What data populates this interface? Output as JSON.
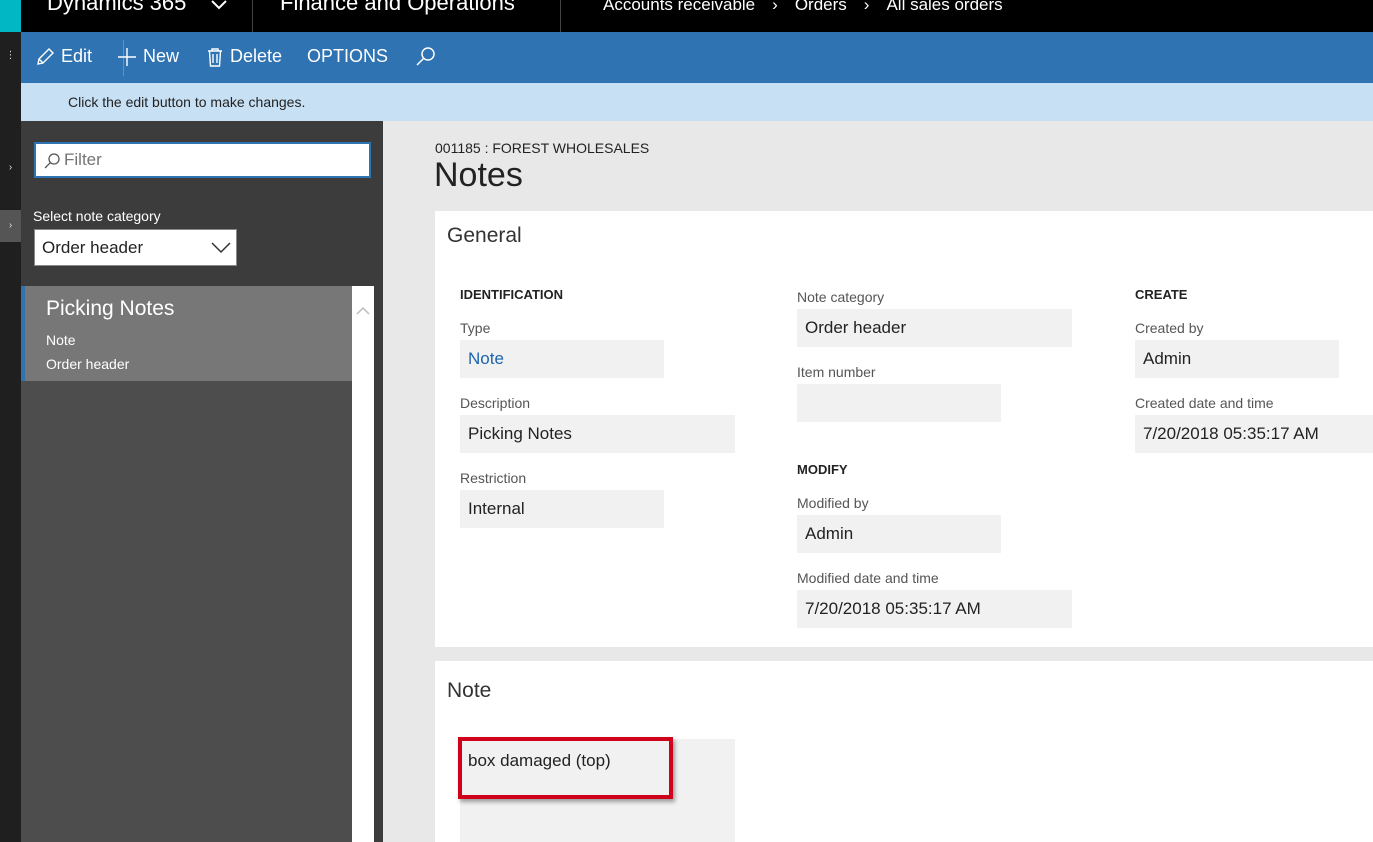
{
  "topbar": {
    "brand": "Dynamics 365",
    "module": "Finance and Operations",
    "breadcrumbs": [
      "Accounts receivable",
      "Orders",
      "All sales orders"
    ]
  },
  "actions": {
    "edit": "Edit",
    "new": "New",
    "delete": "Delete",
    "options": "OPTIONS"
  },
  "info_message": "Click the edit button to make changes.",
  "left_pane": {
    "filter_placeholder": "Filter",
    "category_label": "Select note category",
    "category_value": "Order header",
    "items": [
      {
        "title": "Picking Notes",
        "type": "Note",
        "category": "Order header"
      }
    ]
  },
  "main": {
    "record_caption": "001185 : FOREST WHOLESALES",
    "page_title": "Notes",
    "general": {
      "title": "General",
      "identification": {
        "heading": "IDENTIFICATION",
        "type_label": "Type",
        "type_value": "Note",
        "description_label": "Description",
        "description_value": "Picking Notes",
        "restriction_label": "Restriction",
        "restriction_value": "Internal"
      },
      "category": {
        "note_category_label": "Note category",
        "note_category_value": "Order header",
        "item_number_label": "Item number",
        "item_number_value": ""
      },
      "modify": {
        "heading": "MODIFY",
        "modified_by_label": "Modified by",
        "modified_by_value": "Admin",
        "modified_dt_label": "Modified date and time",
        "modified_dt_value": "7/20/2018 05:35:17 AM"
      },
      "create": {
        "heading": "CREATE",
        "created_by_label": "Created by",
        "created_by_value": "Admin",
        "created_dt_label": "Created date and time",
        "created_dt_value": "7/20/2018 05:35:17 AM"
      }
    },
    "note": {
      "title": "Note",
      "text": "box damaged (top)"
    }
  },
  "colors": {
    "action_pane": "#2f73b3",
    "info_bar": "#c7e0f4",
    "highlight": "#d0021b",
    "link": "#1d64ad"
  }
}
